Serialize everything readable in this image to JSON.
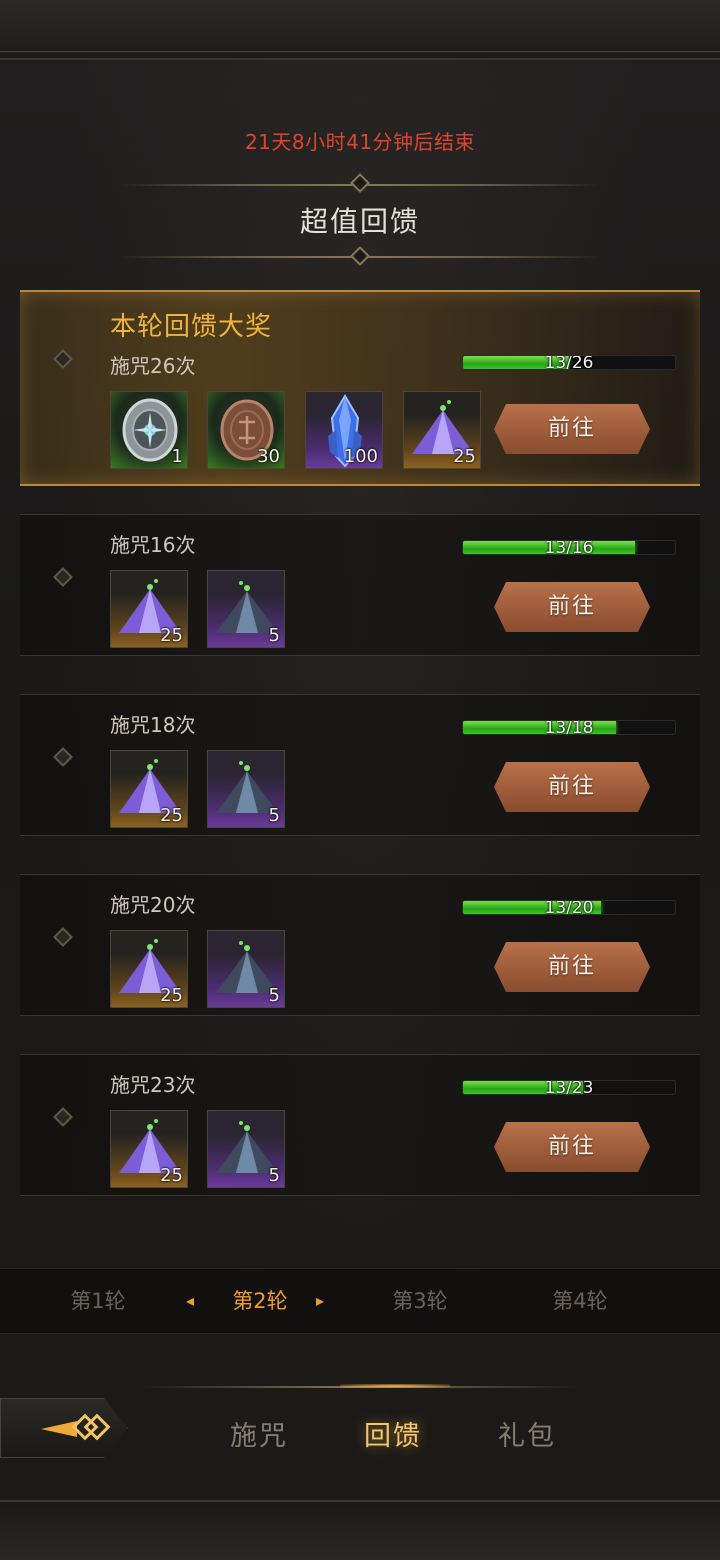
{
  "countdown": "21天8小时41分钟后结束",
  "section_title": "超值回馈",
  "featured": {
    "title": "本轮回馈大奖",
    "requirement": "施咒26次",
    "progress_text": "13/26",
    "progress": 0.5,
    "button": "前往",
    "items": [
      {
        "icon": "silver-medallion-icon",
        "qty": "1",
        "rarity": "green"
      },
      {
        "icon": "bronze-coin-icon",
        "qty": "30",
        "rarity": "green"
      },
      {
        "icon": "blue-crystal-icon",
        "qty": "100",
        "rarity": "purple"
      },
      {
        "icon": "purple-crystal-pile-icon",
        "qty": "25",
        "rarity": "orange"
      }
    ]
  },
  "tasks": [
    {
      "requirement": "施咒16次",
      "progress_text": "13/16",
      "progress": 0.8125,
      "button": "前往",
      "items": [
        {
          "icon": "purple-crystal-pile-icon",
          "qty": "25",
          "rarity": "orange"
        },
        {
          "icon": "dark-crystal-pile-icon",
          "qty": "5",
          "rarity": "purple"
        }
      ]
    },
    {
      "requirement": "施咒18次",
      "progress_text": "13/18",
      "progress": 0.722,
      "button": "前往",
      "items": [
        {
          "icon": "purple-crystal-pile-icon",
          "qty": "25",
          "rarity": "orange"
        },
        {
          "icon": "dark-crystal-pile-icon",
          "qty": "5",
          "rarity": "purple"
        }
      ]
    },
    {
      "requirement": "施咒20次",
      "progress_text": "13/20",
      "progress": 0.65,
      "button": "前往",
      "items": [
        {
          "icon": "purple-crystal-pile-icon",
          "qty": "25",
          "rarity": "orange"
        },
        {
          "icon": "dark-crystal-pile-icon",
          "qty": "5",
          "rarity": "purple"
        }
      ]
    },
    {
      "requirement": "施咒23次",
      "progress_text": "13/23",
      "progress": 0.565,
      "button": "前往",
      "items": [
        {
          "icon": "purple-crystal-pile-icon",
          "qty": "25",
          "rarity": "orange"
        },
        {
          "icon": "dark-crystal-pile-icon",
          "qty": "5",
          "rarity": "purple"
        }
      ]
    }
  ],
  "rounds": [
    {
      "label": "第1轮",
      "active": false
    },
    {
      "label": "第2轮",
      "active": true
    },
    {
      "label": "第3轮",
      "active": false
    },
    {
      "label": "第4轮",
      "active": false
    }
  ],
  "bottom_tabs": [
    {
      "label": "施咒",
      "active": false
    },
    {
      "label": "回馈",
      "active": true
    },
    {
      "label": "礼包",
      "active": false
    }
  ],
  "colors": {
    "countdown": "#e0432f",
    "featured_title": "#f1b43a",
    "progress_green": "#3fc52a",
    "active_tab": "#f3c770",
    "button": "#a05e3c"
  }
}
